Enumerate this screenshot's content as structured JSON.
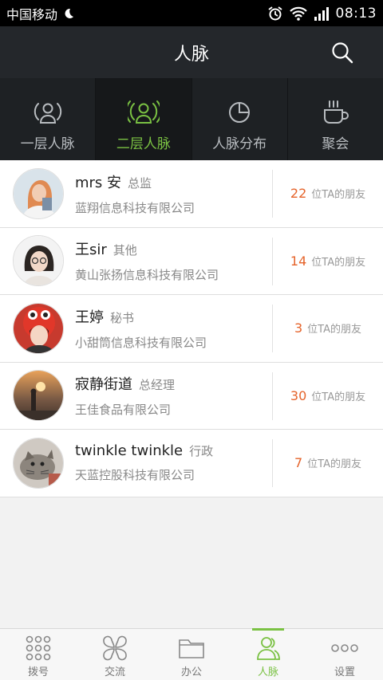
{
  "status": {
    "carrier": "中国移动",
    "time": "08:13"
  },
  "header": {
    "title": "人脉"
  },
  "tabs": [
    {
      "label": "一层人脉",
      "icon": "person-circle-icon",
      "active": false
    },
    {
      "label": "二层人脉",
      "icon": "person-network-icon",
      "active": true
    },
    {
      "label": "人脉分布",
      "icon": "pie-chart-icon",
      "active": false
    },
    {
      "label": "聚会",
      "icon": "coffee-cup-icon",
      "active": false
    }
  ],
  "contacts": [
    {
      "name": "mrs 安",
      "role": "总监",
      "company": "蓝翔信息科技有限公司",
      "count": "22",
      "suffix": "位TA的朋友"
    },
    {
      "name": "王sir",
      "role": "其他",
      "company": "黄山张扬信息科技有限公司",
      "count": "14",
      "suffix": "位TA的朋友"
    },
    {
      "name": "王婷",
      "role": "秘书",
      "company": "小甜筒信息科技有限公司",
      "count": "3",
      "suffix": "位TA的朋友"
    },
    {
      "name": "寂静街道",
      "role": "总经理",
      "company": "王佳食品有限公司",
      "count": "30",
      "suffix": "位TA的朋友"
    },
    {
      "name": "twinkle twinkle",
      "role": "行政",
      "company": "天蓝控股科技有限公司",
      "count": "7",
      "suffix": "位TA的朋友"
    }
  ],
  "bottom_nav": [
    {
      "label": "拨号",
      "icon": "dialpad-icon"
    },
    {
      "label": "交流",
      "icon": "clover-icon"
    },
    {
      "label": "办公",
      "icon": "folder-icon"
    },
    {
      "label": "人脉",
      "icon": "contacts-icon"
    },
    {
      "label": "设置",
      "icon": "more-dots-icon"
    }
  ],
  "colors": {
    "accent": "#7ac143",
    "count": "#e5632a",
    "header": "#24272b"
  }
}
